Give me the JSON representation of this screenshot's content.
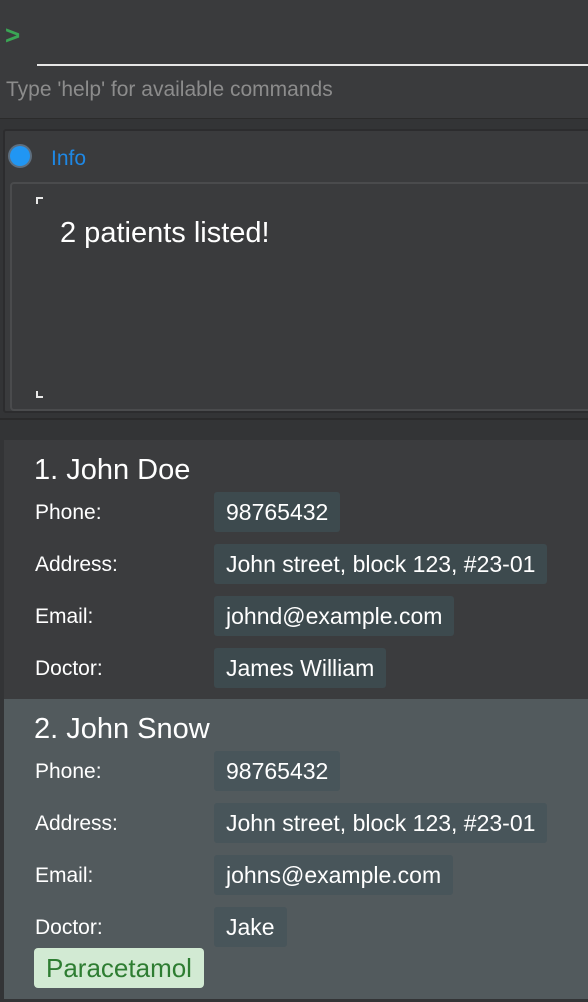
{
  "command": {
    "prompt_symbol": ">",
    "value": "",
    "hint": "Type 'help' for available commands"
  },
  "info": {
    "label": "Info",
    "message": "2 patients listed!"
  },
  "patients": [
    {
      "name": "1. John Doe",
      "phone_label": "Phone:",
      "phone": "98765432",
      "address_label": "Address:",
      "address": "John street, block 123, #23-01",
      "email_label": "Email:",
      "email": "johnd@example.com",
      "doctor_label": "Doctor:",
      "doctor": "James William"
    },
    {
      "name": "2. John Snow",
      "phone_label": "Phone:",
      "phone": "98765432",
      "address_label": "Address:",
      "address": "John street, block 123, #23-01",
      "email_label": "Email:",
      "email": "johns@example.com",
      "doctor_label": "Doctor:",
      "doctor": "Jake",
      "tags": [
        "Paracetamol"
      ]
    }
  ],
  "colors": {
    "prompt": "#3aa655",
    "info_label": "#1e88e5",
    "selected_card": "#525a5d",
    "tag_bg": "#d2ead3",
    "tag_text": "#2e7d32"
  }
}
